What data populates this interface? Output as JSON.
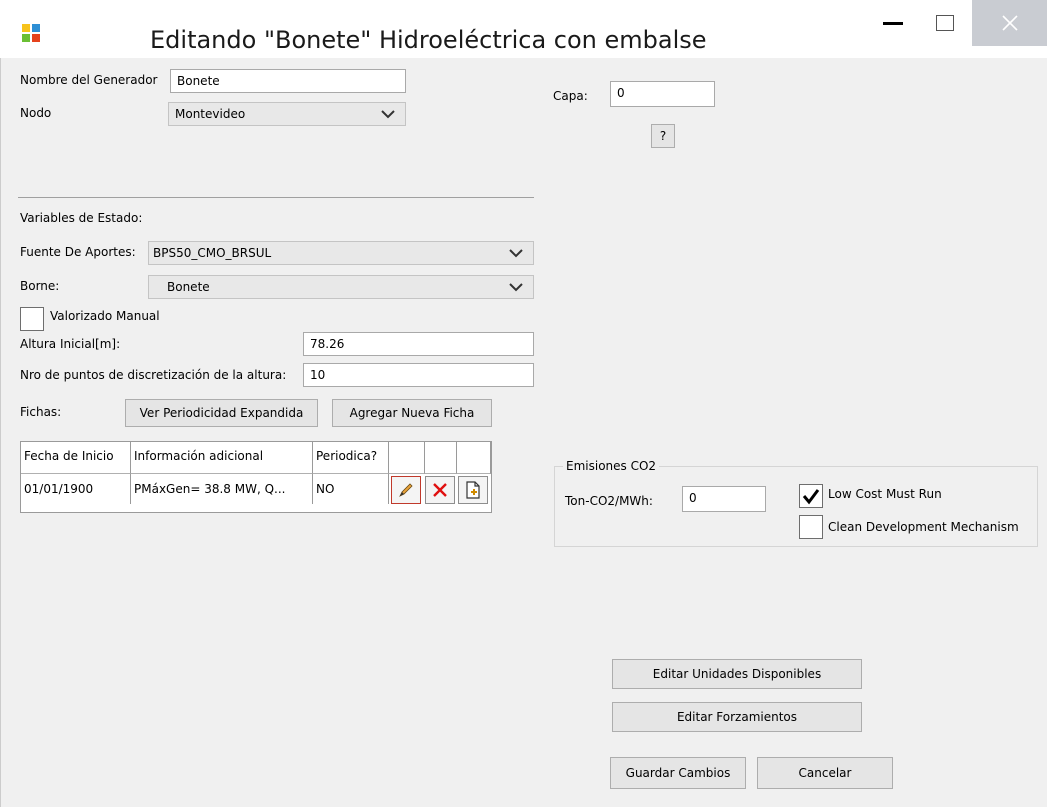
{
  "window": {
    "title": "Editando \"Bonete\" Hidroeléctrica con embalse",
    "minimize_icon": "minimize-icon",
    "maximize_icon": "maximize-icon",
    "close_icon": "close-icon",
    "logo_colors": [
      "#f7c31b",
      "#6bbf34",
      "#2d8fd5",
      "#e5431d"
    ]
  },
  "form": {
    "nombre_label": "Nombre del Generador",
    "nombre_value": "Bonete",
    "nodo_label": "Nodo",
    "nodo_value": "Montevideo",
    "capa_label": "Capa:",
    "capa_value": "0",
    "help_label": "?",
    "variables_label": "Variables de Estado:",
    "fuente_label": "Fuente De Aportes:",
    "fuente_value": "BPS50_CMO_BRSUL",
    "borne_label": "Borne:",
    "borne_value": "Bonete",
    "valorizado_label": "Valorizado Manual",
    "altura_label": "Altura Inicial[m]:",
    "altura_value": "78.26",
    "nro_puntos_label": "Nro de puntos de discretización de la altura:",
    "nro_puntos_value": "10",
    "fichas_label": "Fichas:",
    "ver_periodicidad_label": "Ver Periodicidad Expandida",
    "agregar_ficha_label": "Agregar Nueva Ficha"
  },
  "fichas_table": {
    "columns": [
      "Fecha de Inicio",
      "Información adicional",
      "Periodica?"
    ],
    "rows": [
      {
        "fecha": "01/01/1900",
        "info": "PMáxGen= 38.8 MW, Q...",
        "periodica": "NO"
      }
    ],
    "row_actions": [
      "edit-icon",
      "delete-icon",
      "new-document-icon"
    ]
  },
  "emisiones": {
    "group_title": "Emisiones CO2",
    "ton_label": "Ton-CO2/MWh:",
    "ton_value": "0",
    "low_cost_label": "Low Cost Must Run",
    "low_cost_checked": true,
    "clean_dev_label": "Clean Development Mechanism",
    "clean_dev_checked": false
  },
  "actions": {
    "editar_unidades_label": "Editar Unidades Disponibles",
    "editar_forzamientos_label": "Editar Forzamientos",
    "guardar_label": "Guardar Cambios",
    "cancelar_label": "Cancelar"
  }
}
